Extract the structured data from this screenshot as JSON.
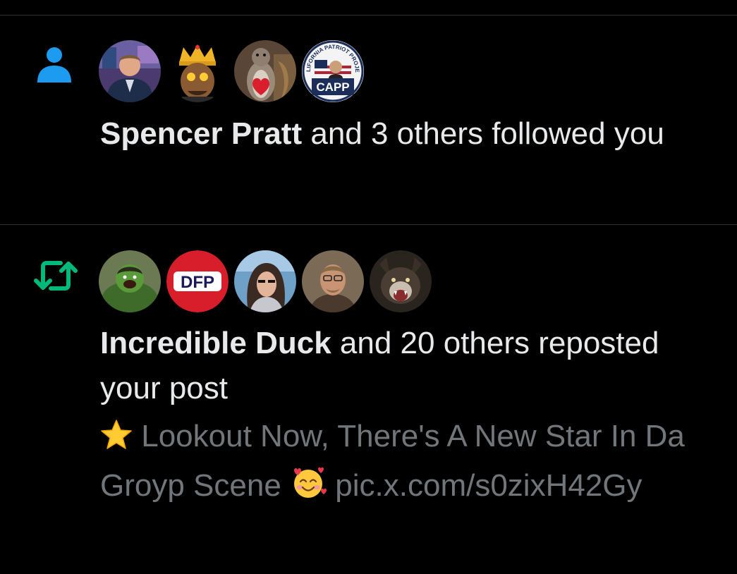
{
  "colors": {
    "background": "#000000",
    "divider": "#2f3336",
    "primary_text": "#e7e9ea",
    "secondary_text": "#71767b",
    "follow_icon": "#1d9bf0",
    "repost_icon": "#00ba7c",
    "star": "#ffcc33"
  },
  "notifications": [
    {
      "type": "follow",
      "icon": "person-icon",
      "avatars": [
        {
          "name": "spencer-pratt-avatar"
        },
        {
          "name": "crowned-cartoon-avatar"
        },
        {
          "name": "squirrel-heart-avatar"
        },
        {
          "name": "capp-avatar",
          "badge_text": "CAPP",
          "ring_text": "CALIFORNIA PATRIOT PROJECT"
        }
      ],
      "actor": "Spencer Pratt",
      "action": "and 3 others followed you"
    },
    {
      "type": "repost",
      "icon": "repost-icon",
      "avatars": [
        {
          "name": "hulk-avatar"
        },
        {
          "name": "dfp-avatar",
          "badge_text": "DFP"
        },
        {
          "name": "woman-avatar"
        },
        {
          "name": "man-glasses-avatar"
        },
        {
          "name": "snarling-dog-avatar"
        }
      ],
      "actor": "Incredible Duck",
      "action": "and 20 others reposted your post",
      "preview": {
        "leading_emoji": "star-emoji",
        "text_part1": "Lookout Now, There's A New Star In Da Groyp Scene",
        "trailing_emoji": "smiling-face-with-hearts-emoji",
        "text_part2": "pic.x.com/s0zixH42Gy"
      }
    }
  ]
}
